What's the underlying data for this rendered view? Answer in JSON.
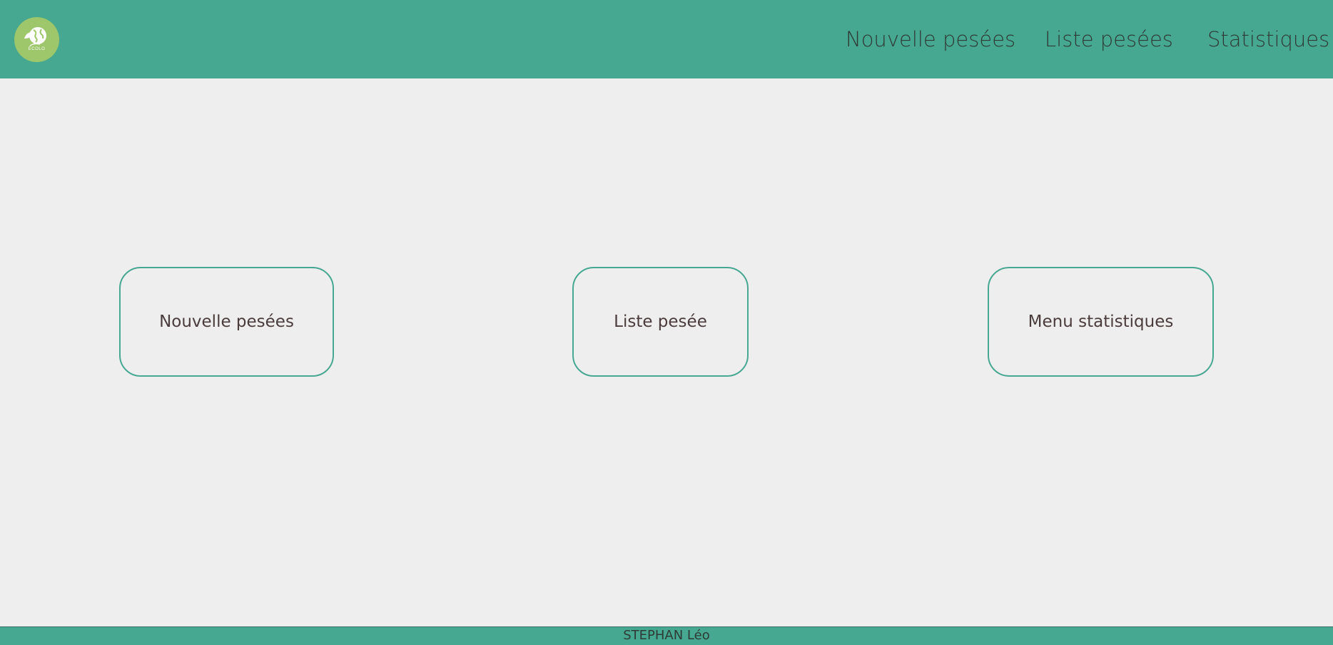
{
  "header": {
    "logo_text": "ECOLO",
    "nav": [
      {
        "label": "Nouvelle pesées"
      },
      {
        "label": "Liste pesées"
      },
      {
        "label": "Statistiques"
      }
    ]
  },
  "main": {
    "tiles": [
      {
        "label": "Nouvelle pesées"
      },
      {
        "label": "Liste pesée"
      },
      {
        "label": "Menu statistiques"
      }
    ]
  },
  "footer": {
    "text": "STEPHAN Léo"
  },
  "colors": {
    "header_bg": "#47a892",
    "page_bg": "#eeeeee",
    "logo_bg": "#9dc76a",
    "tile_border": "#47a892"
  }
}
